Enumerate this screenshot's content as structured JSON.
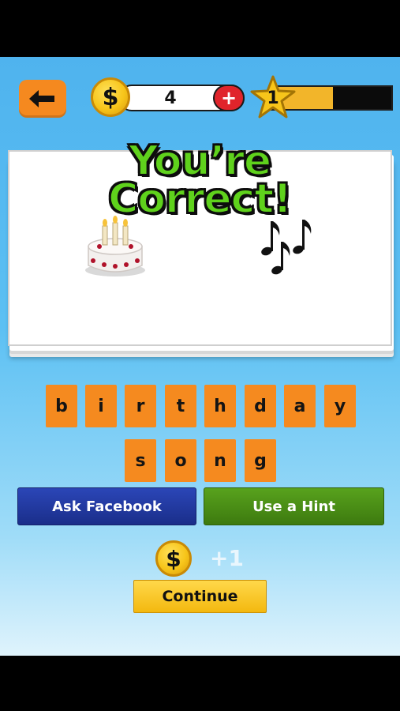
{
  "header": {
    "back_icon": "arrow-left-icon",
    "coin_symbol": "$",
    "coins": "4",
    "add_coins_symbol": "+",
    "level": "1",
    "level_progress": 0.52
  },
  "result": {
    "title_line1": "You’re",
    "title_line2": "Correct!"
  },
  "puzzle": {
    "emojis": [
      "birthday-cake-icon",
      "musical-notes-icon"
    ],
    "answer_words": [
      [
        "b",
        "i",
        "r",
        "t",
        "h",
        "d",
        "a",
        "y"
      ],
      [
        "s",
        "o",
        "n",
        "g"
      ]
    ]
  },
  "actions": {
    "ask_facebook": "Ask Facebook",
    "use_hint": "Use a Hint"
  },
  "reward": {
    "coin_symbol": "$",
    "amount": "+1"
  },
  "continue_label": "Continue",
  "colors": {
    "sky_blue": "#5cc0f3",
    "tile_orange": "#f58a1f",
    "correct_green": "#5fd21c",
    "facebook_blue": "#1f3a9e",
    "hint_green": "#4a8e16",
    "continue_yellow": "#f7c51a"
  }
}
